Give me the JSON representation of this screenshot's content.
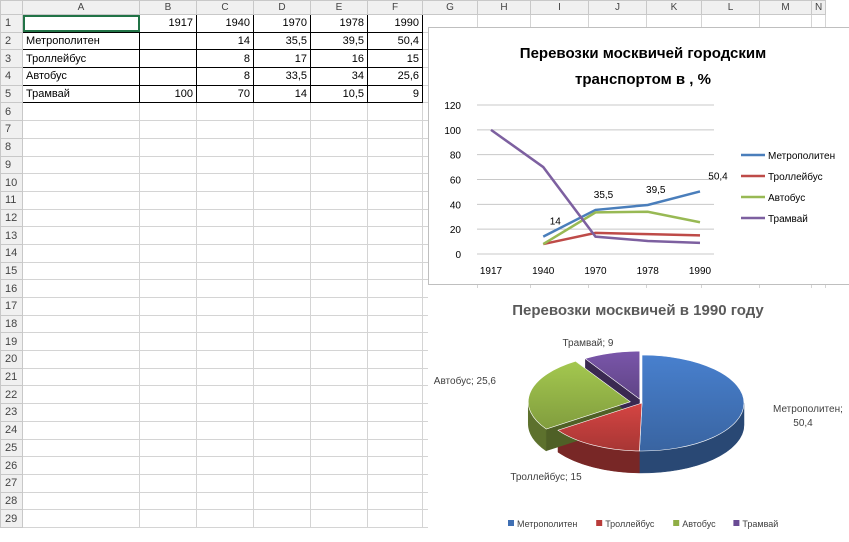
{
  "sheet": {
    "columns": [
      "A",
      "B",
      "C",
      "D",
      "E",
      "F",
      "G",
      "H",
      "I",
      "J",
      "K",
      "L",
      "M",
      "N"
    ],
    "rows": [
      "1",
      "2",
      "3",
      "4",
      "5",
      "6",
      "7",
      "8",
      "9",
      "10",
      "11",
      "12",
      "13",
      "14",
      "15",
      "16",
      "17",
      "18",
      "19",
      "20",
      "21",
      "22",
      "23",
      "24",
      "25",
      "26",
      "27",
      "28",
      "29"
    ],
    "cells": [
      [
        "",
        "1917",
        "1940",
        "1970",
        "1978",
        "1990"
      ],
      [
        "Метрополитен",
        "",
        "14",
        "35,5",
        "39,5",
        "50,4"
      ],
      [
        "Троллейбус",
        "",
        "8",
        "17",
        "16",
        "15"
      ],
      [
        "Автобус",
        "",
        "8",
        "33,5",
        "34",
        "25,6"
      ],
      [
        "Трамвай",
        "100",
        "70",
        "14",
        "10,5",
        "9"
      ]
    ]
  },
  "chart_data": [
    {
      "type": "line",
      "title": "Перевозки москвичей городским транспортом в , %",
      "x": [
        "1917",
        "1940",
        "1970",
        "1978",
        "1990"
      ],
      "ylim": [
        0,
        120
      ],
      "yticks": [
        "0",
        "20",
        "40",
        "60",
        "80",
        "100",
        "120"
      ],
      "grid": true,
      "legend": "right",
      "series": [
        {
          "name": "Метрополитен",
          "values": [
            null,
            14,
            35.5,
            39.5,
            50.4
          ],
          "color": "#4a7ebb",
          "labels": [
            "",
            "14",
            "35,5",
            "39,5",
            "50,4"
          ]
        },
        {
          "name": "Троллейбус",
          "values": [
            null,
            8,
            17,
            16,
            15
          ],
          "color": "#be4b48"
        },
        {
          "name": "Автобус",
          "values": [
            null,
            8,
            33.5,
            34,
            25.6
          ],
          "color": "#98b954"
        },
        {
          "name": "Трамвай",
          "values": [
            100,
            70,
            14,
            10.5,
            9
          ],
          "color": "#7d60a0"
        }
      ]
    },
    {
      "type": "pie",
      "title": "Перевозки москвичей в 1990 году",
      "legend": "bottom",
      "slices": [
        {
          "name": "Метрополитен",
          "value": 50.4,
          "color": "#3f6fb3",
          "label": "Метрополитен; 50,4"
        },
        {
          "name": "Троллейбус",
          "value": 15,
          "color": "#b93c3a",
          "label": "Троллейбус; 15"
        },
        {
          "name": "Автобус",
          "value": 25.6,
          "color": "#8fae45",
          "label": "Автобус; 25,6"
        },
        {
          "name": "Трамвай",
          "value": 9,
          "color": "#6a4b94",
          "label": "Трамвай; 9"
        }
      ]
    }
  ]
}
